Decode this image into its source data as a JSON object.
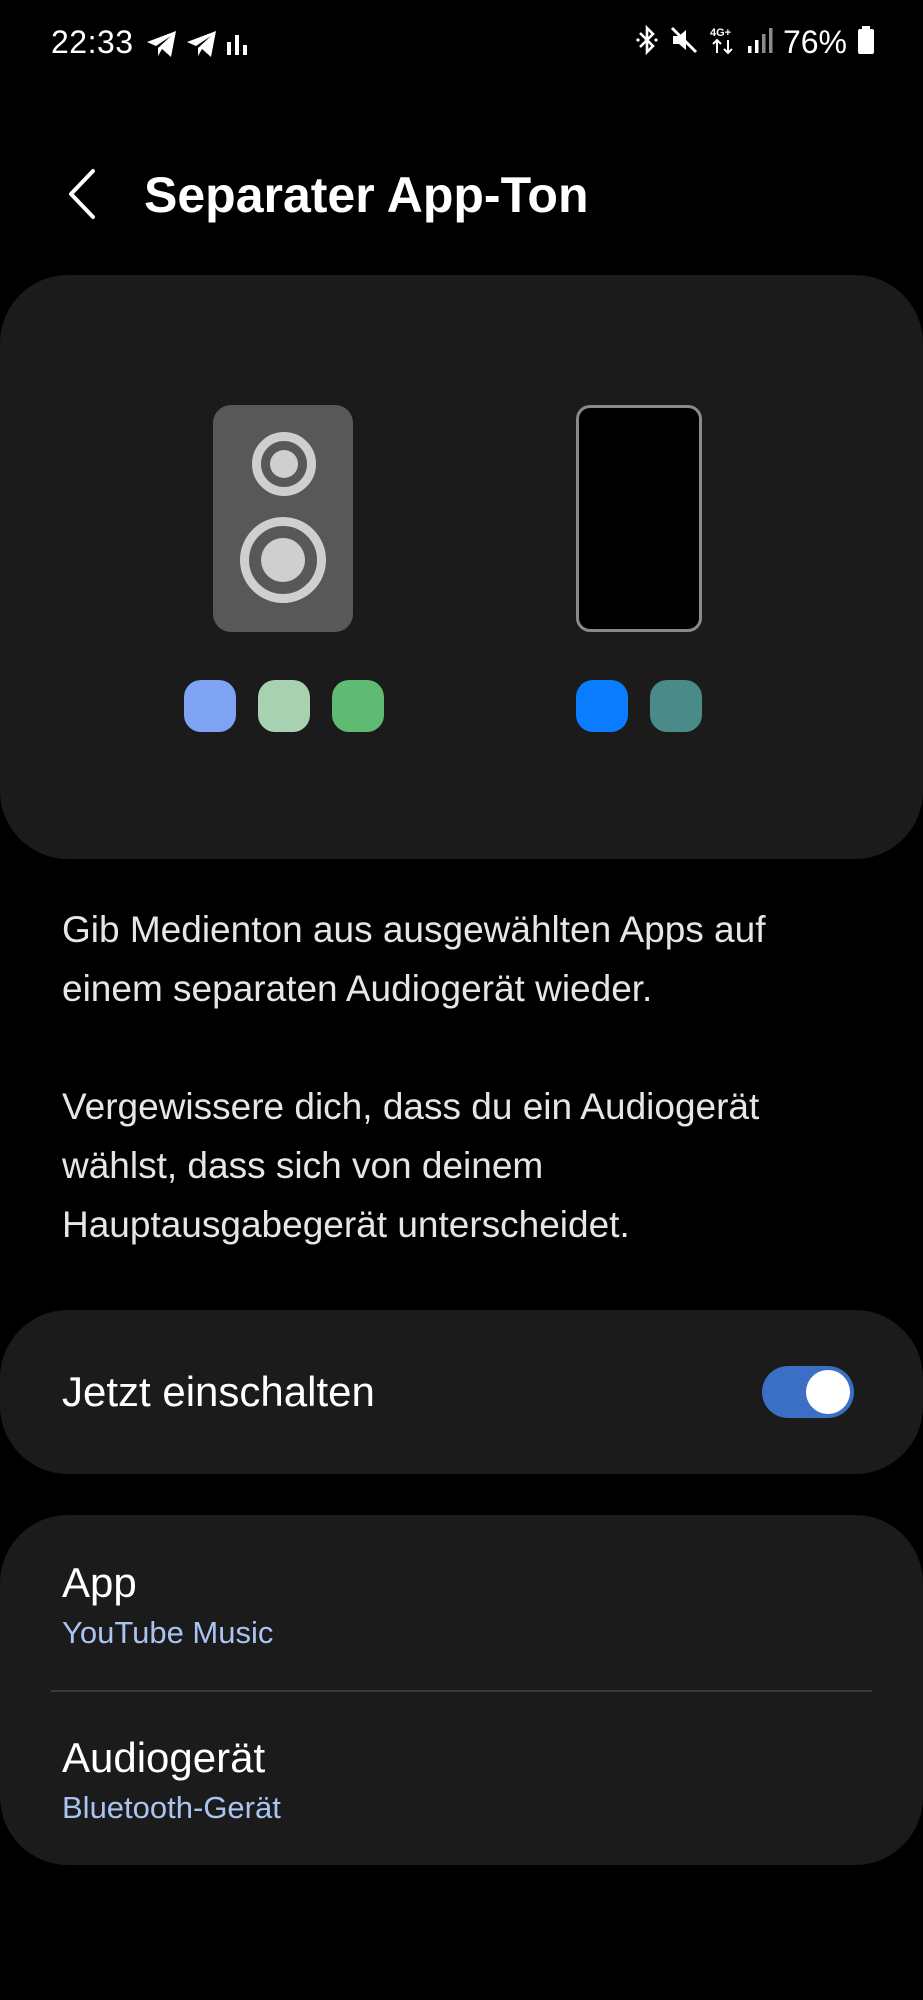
{
  "status_bar": {
    "time": "22:33",
    "left_icons": [
      "telegram-icon",
      "telegram-icon",
      "activity-bars-icon"
    ],
    "right_icons": [
      "bluetooth-icon",
      "mute-icon",
      "network-4g-icon",
      "signal-icon",
      "battery-icon"
    ],
    "battery_percent": "76%"
  },
  "header": {
    "back_icon": "chevron-left-icon",
    "title": "Separater App-Ton"
  },
  "illustration": {
    "speaker_color": "#585858",
    "phone_border_color": "#8a8a8a",
    "speaker_app_colors": [
      "#7ea3f2",
      "#a7d1b0",
      "#5fba73"
    ],
    "phone_app_colors": [
      "#0a7cff",
      "#4a8b89"
    ]
  },
  "description": {
    "paragraph_1": "Gib Medienton aus ausgewählten Apps auf einem separaten Audiogerät wieder.",
    "paragraph_2": "Vergewissere dich, dass du ein Audiogerät wählst, dass sich von deinem Hauptausgabegerät unterscheidet."
  },
  "toggle": {
    "label": "Jetzt einschalten",
    "state": "on",
    "accent_color": "#3a6fc4"
  },
  "settings": {
    "app": {
      "title": "App",
      "value": "YouTube Music"
    },
    "audio_device": {
      "title": "Audiogerät",
      "value": "Bluetooth-Gerät"
    },
    "value_color": "#a9c4f0"
  }
}
